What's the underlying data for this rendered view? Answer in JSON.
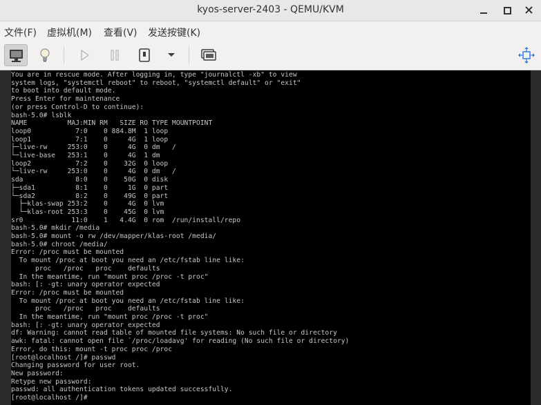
{
  "window": {
    "title": "kyos-server-2403 - QEMU/KVM"
  },
  "menubar": {
    "items": [
      "文件(F)",
      "虚拟机(M)",
      "查看(V)",
      "发送按键(K)"
    ]
  },
  "toolbar": {
    "buttons": [
      {
        "name": "console-view-button",
        "icon": "monitor-icon"
      },
      {
        "name": "details-view-button",
        "icon": "lightbulb-icon"
      },
      {
        "name": "run-button",
        "icon": "play-icon"
      },
      {
        "name": "pause-button",
        "icon": "pause-icon"
      },
      {
        "name": "shutdown-button",
        "icon": "power-icon"
      },
      {
        "name": "shutdown-menu-button",
        "icon": "chevron-down-icon"
      },
      {
        "name": "snapshots-button",
        "icon": "snapshot-icon"
      },
      {
        "name": "fullscreen-button",
        "icon": "resize-icon"
      }
    ]
  },
  "console": {
    "lines": [
      "You are in rescue mode. After logging in, type \"journalctl -xb\" to view",
      "system logs, \"systemctl reboot\" to reboot, \"systemctl default\" or \"exit\"",
      "to boot into default mode.",
      "Press Enter for maintenance",
      "(or press Control-D to continue):",
      "bash-5.0# lsblk",
      "NAME          MAJ:MIN RM   SIZE RO TYPE MOUNTPOINT",
      "loop0           7:0    0 884.8M  1 loop",
      "loop1           7:1    0     4G  1 loop",
      "├─live-rw     253:0    0     4G  0 dm   /",
      "└─live-base   253:1    0     4G  1 dm",
      "loop2           7:2    0    32G  0 loop",
      "└─live-rw     253:0    0     4G  0 dm   /",
      "sda             8:0    0    50G  0 disk",
      "├─sda1          8:1    0     1G  0 part",
      "└─sda2          8:2    0    49G  0 part",
      "  ├─klas-swap 253:2    0     4G  0 lvm",
      "  └─klas-root 253:3    0    45G  0 lvm",
      "sr0            11:0    1   4.4G  0 rom  /run/install/repo",
      "bash-5.0# mkdir /media",
      "bash-5.0# mount -o rw /dev/mapper/klas-root /media/",
      "bash-5.0# chroot /media/",
      "Error: /proc must be mounted",
      "  To mount /proc at boot you need an /etc/fstab line like:",
      "      proc   /proc   proc    defaults",
      "  In the meantime, run \"mount proc /proc -t proc\"",
      "bash: [: -gt: unary operator expected",
      "Error: /proc must be mounted",
      "  To mount /proc at boot you need an /etc/fstab line like:",
      "      proc   /proc   proc    defaults",
      "  In the meantime, run \"mount proc /proc -t proc\"",
      "bash: [: -gt: unary operator expected",
      "df: Warning: cannot read table of mounted file systems: No such file or directory",
      "awk: fatal: cannot open file `/proc/loadavg' for reading (No such file or directory)",
      "Error, do this: mount -t proc proc /proc",
      "[root@localhost /]# passwd",
      "Changing password for user root.",
      "New password:",
      "Retype new password:",
      "passwd: all authentication tokens updated successfully.",
      "[root@localhost /]# "
    ]
  }
}
